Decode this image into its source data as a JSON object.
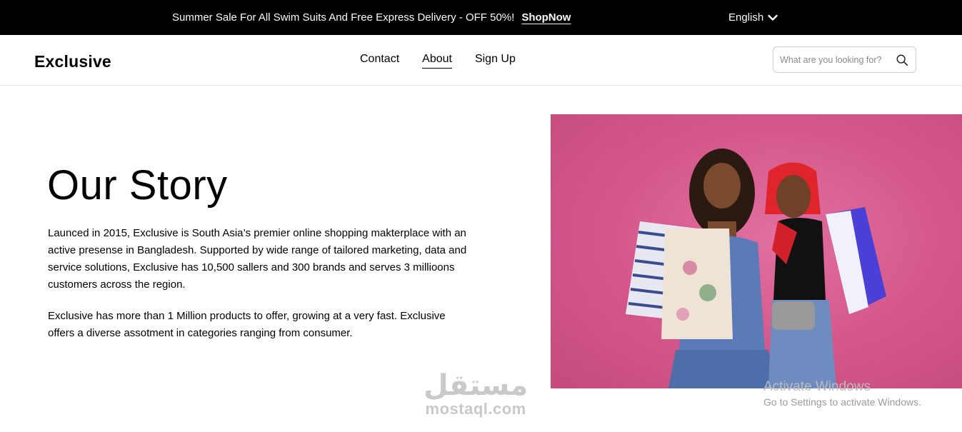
{
  "topbar": {
    "promo_text": "Summer Sale For All Swim Suits And Free Express Delivery - OFF 50%!",
    "promo_link": "ShopNow",
    "language": "English"
  },
  "header": {
    "logo": "Exclusive",
    "nav": [
      "Contact",
      "About",
      "Sign Up"
    ],
    "active_nav": "About",
    "search_placeholder": "What are you looking for?"
  },
  "story": {
    "title": "Our Story",
    "paragraph1": "Launced in 2015, Exclusive is South Asia’s premier online shopping makterplace with an active presense in Bangladesh. Supported by wide range of tailored marketing, data and service solutions, Exclusive has 10,500 sallers and 300 brands and serves 3 millioons customers across the region.",
    "paragraph2": "Exclusive has more than 1 Million products to offer, growing at a very fast. Exclusive offers a diverse assotment in categories ranging from consumer."
  },
  "watermark": {
    "arabic": "مستقل",
    "latin": "mostaql.com"
  },
  "os_overlay": {
    "title": "Activate Windows",
    "subtitle": "Go to Settings to activate Windows."
  },
  "colors": {
    "topbar_bg": "#000000",
    "hero_bg": "#d4568a"
  }
}
